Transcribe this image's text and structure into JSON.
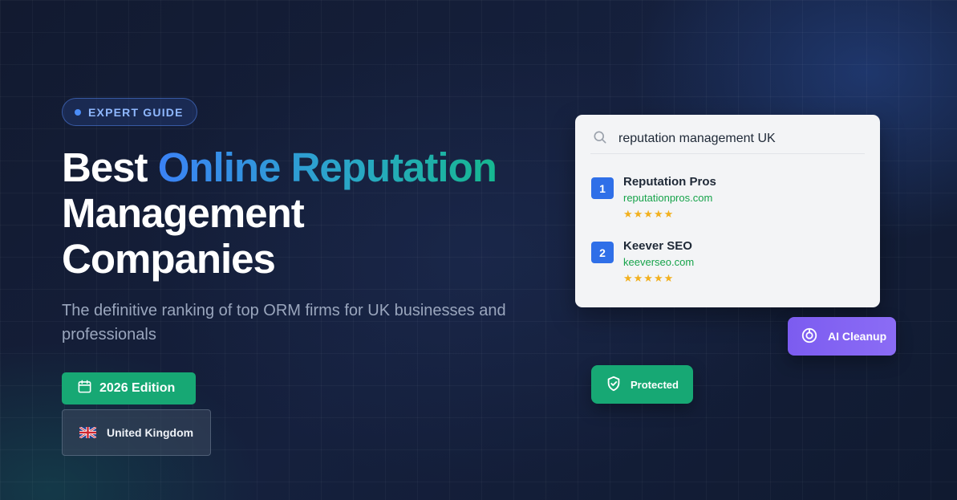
{
  "badge": {
    "label": "EXPERT GUIDE"
  },
  "hero": {
    "title_plain_1": "Best ",
    "title_highlight": "Online Reputation",
    "title_line_2": "Management",
    "title_line_3": "Companies",
    "subtitle": "The definitive ranking of top ORM firms for UK businesses and professionals"
  },
  "edition": {
    "label": "2026 Edition",
    "icon": "calendar-icon"
  },
  "country": {
    "label": "United Kingdom",
    "icon": "uk-flag-icon"
  },
  "search_card": {
    "query": "reputation management UK",
    "icon": "search-icon",
    "results": [
      {
        "rank": "1",
        "name": "Reputation Pros",
        "url": "reputationpros.com",
        "stars": "★★★★★",
        "rating": 5
      },
      {
        "rank": "2",
        "name": "Keever SEO",
        "url": "keeverseo.com",
        "stars": "★★★★★",
        "rating": 5
      }
    ]
  },
  "ai_button": {
    "label": "AI Cleanup",
    "icon": "ai-target-icon"
  },
  "protected_button": {
    "label": "Protected",
    "icon": "shield-check-icon"
  },
  "colors": {
    "accent_blue": "#3b82f6",
    "accent_green": "#17a874",
    "accent_purple": "#7c5cf0",
    "star_gold": "#f2b01e"
  }
}
